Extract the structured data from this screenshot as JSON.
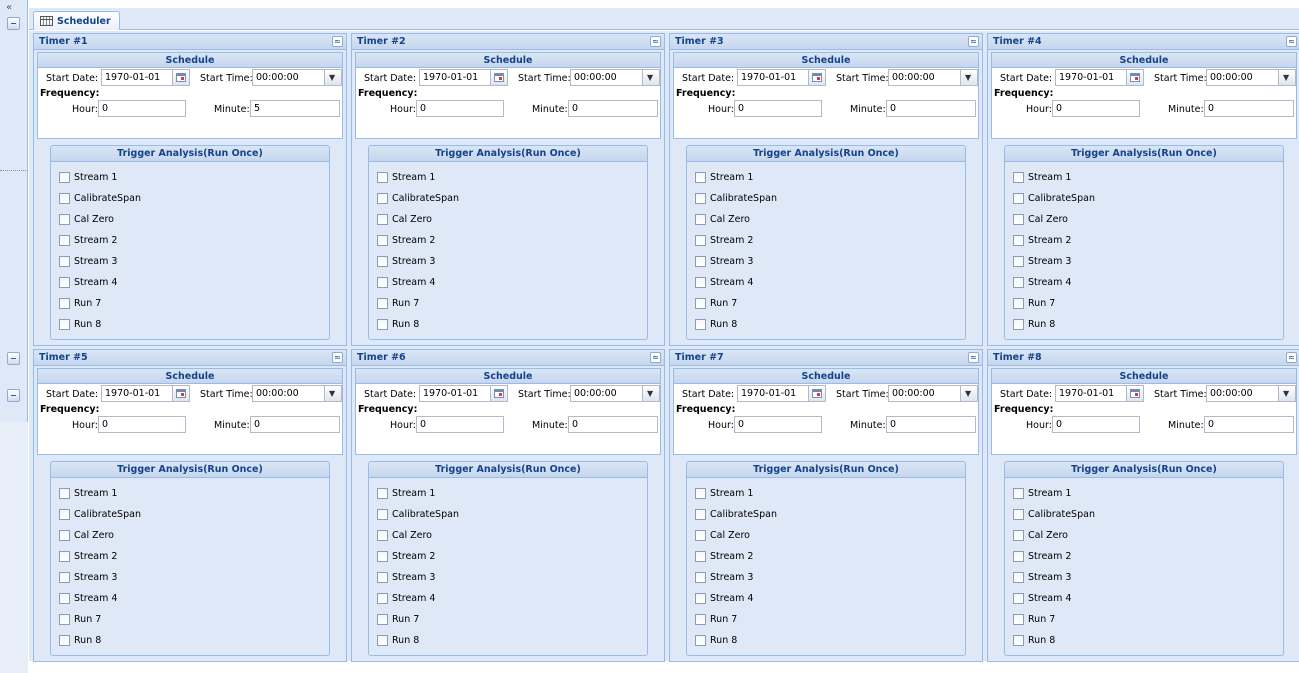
{
  "tab": {
    "label": "Scheduler",
    "icon": "calendar-icon"
  },
  "schedule_title": "Schedule",
  "labels": {
    "start_date": "Start Date:",
    "start_time": "Start Time:",
    "frequency": "Frequency:",
    "hour": "Hour:",
    "minute": "Minute:"
  },
  "trigger_title": "Trigger Analysis(Run Once)",
  "trigger_items": [
    "Stream 1",
    "CalibrateSpan",
    "Cal Zero",
    "Stream 2",
    "Stream 3",
    "Stream 4",
    "Run 7",
    "Run 8"
  ],
  "timers": [
    {
      "title": "Timer #1",
      "start_date": "1970-01-01",
      "start_time": "00:00:00",
      "hour": "0",
      "minute": "5"
    },
    {
      "title": "Timer #2",
      "start_date": "1970-01-01",
      "start_time": "00:00:00",
      "hour": "0",
      "minute": "0"
    },
    {
      "title": "Timer #3",
      "start_date": "1970-01-01",
      "start_time": "00:00:00",
      "hour": "0",
      "minute": "0"
    },
    {
      "title": "Timer #4",
      "start_date": "1970-01-01",
      "start_time": "00:00:00",
      "hour": "0",
      "minute": "0"
    },
    {
      "title": "Timer #5",
      "start_date": "1970-01-01",
      "start_time": "00:00:00",
      "hour": "0",
      "minute": "0"
    },
    {
      "title": "Timer #6",
      "start_date": "1970-01-01",
      "start_time": "00:00:00",
      "hour": "0",
      "minute": "0"
    },
    {
      "title": "Timer #7",
      "start_date": "1970-01-01",
      "start_time": "00:00:00",
      "hour": "0",
      "minute": "0"
    },
    {
      "title": "Timer #8",
      "start_date": "1970-01-01",
      "start_time": "00:00:00",
      "hour": "0",
      "minute": "0"
    }
  ],
  "colors": {
    "panel_bg": "#dfe8f6",
    "border": "#99bbe8",
    "header_text": "#15428b"
  }
}
